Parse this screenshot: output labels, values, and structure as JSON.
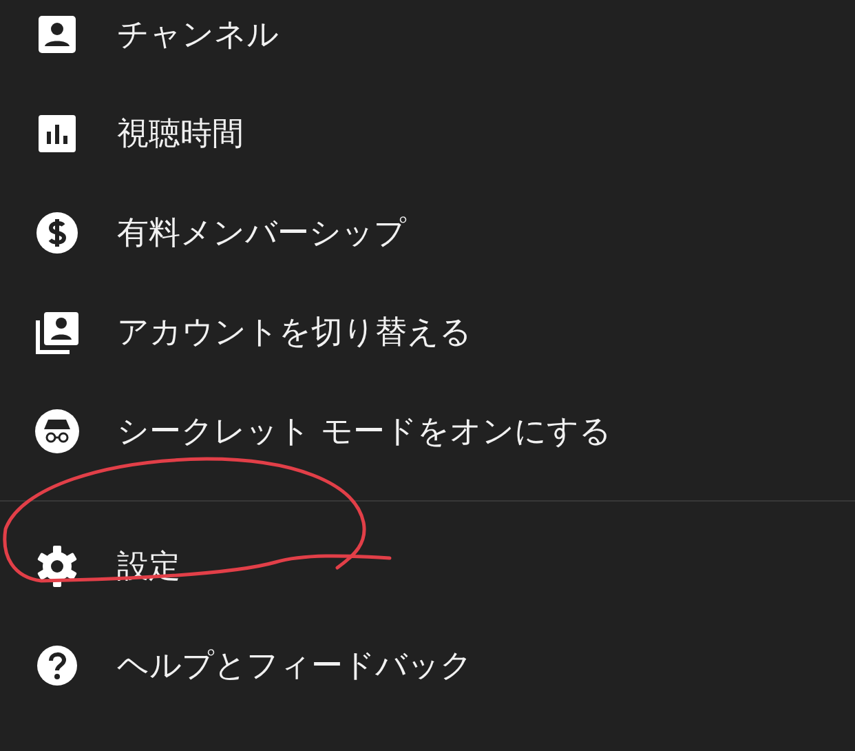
{
  "menu": {
    "sections": [
      {
        "items": [
          {
            "label": "チャンネル"
          },
          {
            "label": "視聴時間"
          },
          {
            "label": "有料メンバーシップ"
          },
          {
            "label": "アカウントを切り替える"
          },
          {
            "label": "シークレット モードをオンにする"
          }
        ]
      },
      {
        "items": [
          {
            "label": "設定"
          },
          {
            "label": "ヘルプとフィードバック"
          }
        ]
      }
    ]
  }
}
